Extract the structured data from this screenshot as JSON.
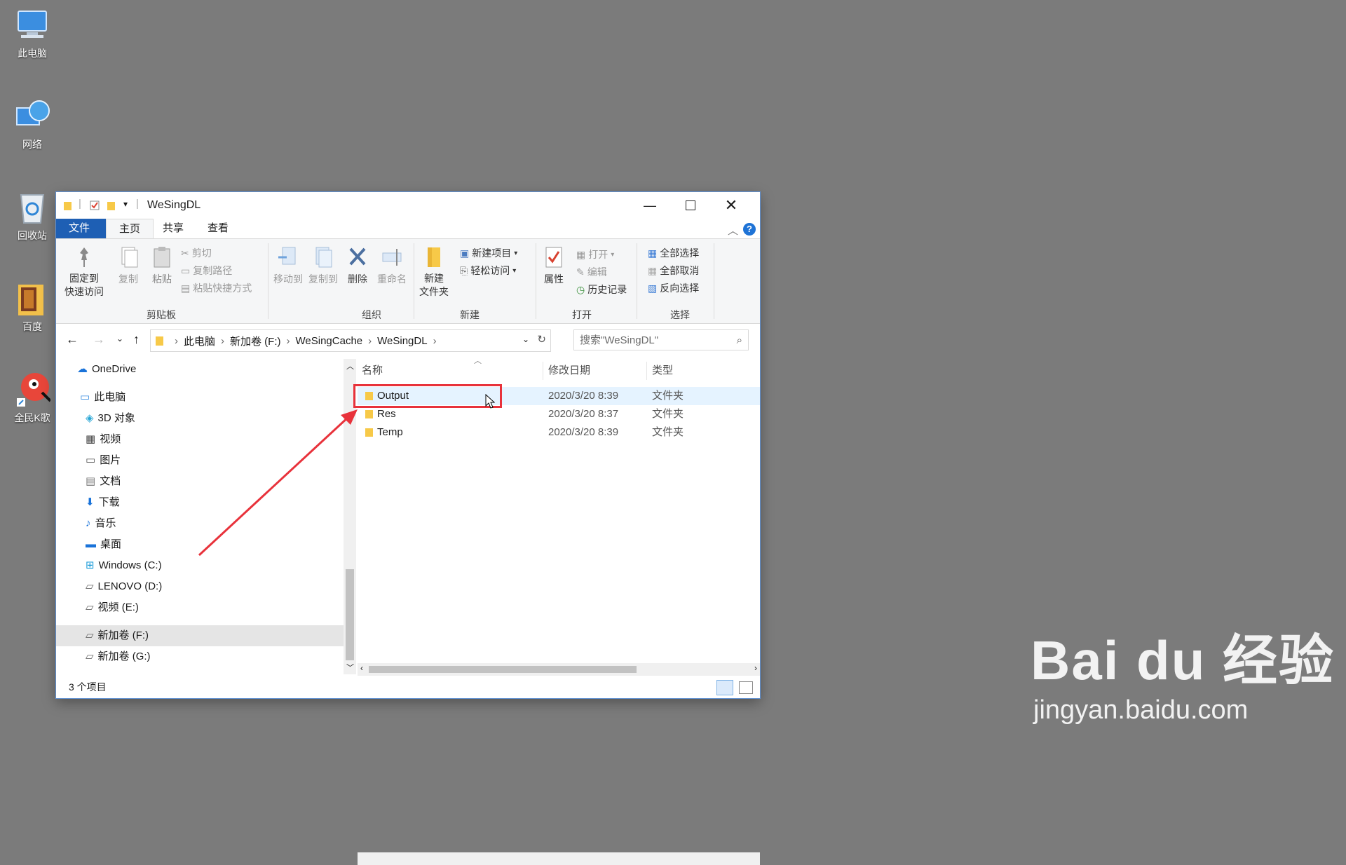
{
  "desktop": {
    "icons": [
      {
        "label": "此电脑"
      },
      {
        "label": "网络"
      },
      {
        "label": "回收站"
      },
      {
        "label": "百度"
      },
      {
        "label": "全民K歌"
      }
    ]
  },
  "window": {
    "title": "WeSingDL",
    "tabs": [
      "文件",
      "主页",
      "共享",
      "查看"
    ],
    "ribbon": {
      "clipboard": {
        "pin": "固定到\n快速访问",
        "copy": "复制",
        "paste": "粘贴",
        "cut": "剪切",
        "copy_path": "复制路径",
        "paste_shortcut": "粘贴快捷方式",
        "group": "剪贴板"
      },
      "organize": {
        "move_to": "移动到",
        "copy_to": "复制到",
        "delete": "删除",
        "rename": "重命名",
        "group": "组织"
      },
      "new": {
        "new_folder": "新建\n文件夹",
        "new_item": "新建项目",
        "easy_access": "轻松访问",
        "group": "新建"
      },
      "open": {
        "properties": "属性",
        "open": "打开",
        "edit": "编辑",
        "history": "历史记录",
        "group": "打开"
      },
      "select": {
        "select_all": "全部选择",
        "select_none": "全部取消",
        "invert": "反向选择",
        "group": "选择"
      }
    },
    "address": {
      "crumbs": [
        "此电脑",
        "新加卷 (F:)",
        "WeSingCache",
        "WeSingDL"
      ],
      "search_placeholder": "搜索\"WeSingDL\""
    },
    "nav": {
      "onedrive": "OneDrive",
      "this_pc": "此电脑",
      "items": [
        "3D 对象",
        "视频",
        "图片",
        "文档",
        "下载",
        "音乐",
        "桌面",
        "Windows (C:)",
        "LENOVO (D:)",
        "视频 (E:)",
        "新加卷 (F:)",
        "新加卷 (G:)"
      ]
    },
    "columns": {
      "name": "名称",
      "modified": "修改日期",
      "type": "类型"
    },
    "files": [
      {
        "name": "Output",
        "modified": "2020/3/20 8:39",
        "type": "文件夹"
      },
      {
        "name": "Res",
        "modified": "2020/3/20 8:37",
        "type": "文件夹"
      },
      {
        "name": "Temp",
        "modified": "2020/3/20 8:39",
        "type": "文件夹"
      }
    ],
    "status": "3 个项目"
  },
  "watermark": {
    "brand": "Bai du 经验",
    "url": "jingyan.baidu.com"
  },
  "colors": {
    "folder": "#f7c948",
    "accent": "#1e5fb4",
    "annotation": "#e8323b"
  }
}
